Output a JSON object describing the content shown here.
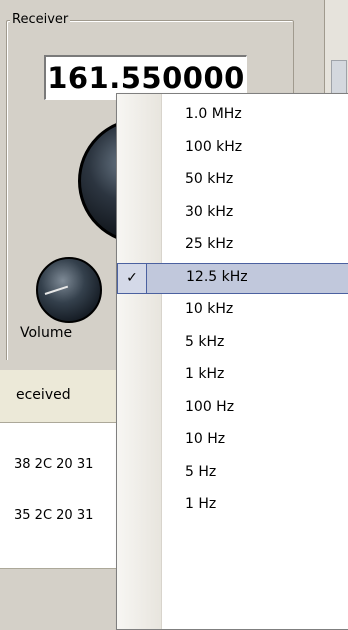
{
  "receiver": {
    "legend": "Receiver",
    "frequency": "161.550000",
    "volume_label": "Volume"
  },
  "received": {
    "header": "eceived",
    "rows": [
      "38 2C 20 31",
      "35 2C 20 31"
    ]
  },
  "step_menu": {
    "items": [
      {
        "label": "1.0 MHz",
        "checked": false
      },
      {
        "label": "100 kHz",
        "checked": false
      },
      {
        "label": "50 kHz",
        "checked": false
      },
      {
        "label": "30 kHz",
        "checked": false
      },
      {
        "label": "25 kHz",
        "checked": false
      },
      {
        "label": "12.5 kHz",
        "checked": true
      },
      {
        "label": "10 kHz",
        "checked": false
      },
      {
        "label": "5 kHz",
        "checked": false
      },
      {
        "label": "1 kHz",
        "checked": false
      },
      {
        "label": "100 Hz",
        "checked": false
      },
      {
        "label": "10 Hz",
        "checked": false
      },
      {
        "label": "5 Hz",
        "checked": false
      },
      {
        "label": "1 Hz",
        "checked": false
      }
    ],
    "check_glyph": "✓",
    "selection_color": "#c1c8dc"
  }
}
